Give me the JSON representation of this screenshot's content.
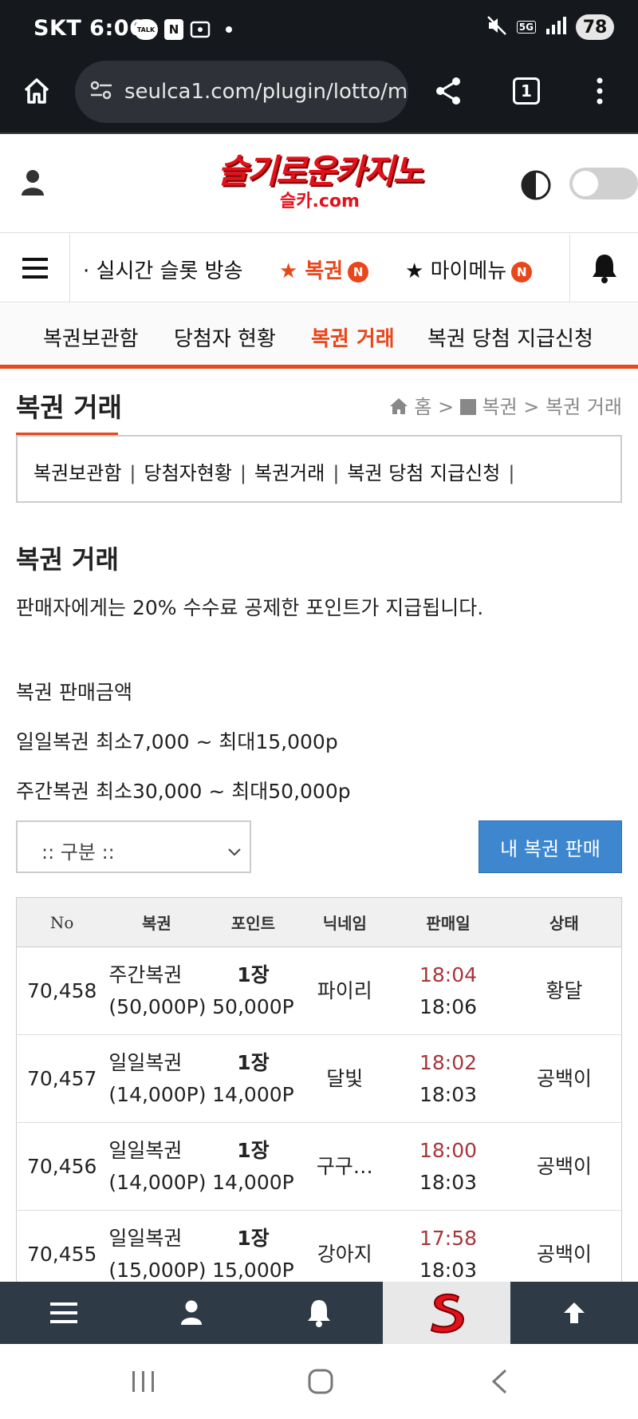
{
  "status": {
    "carrier_time": "SKT 6:06",
    "talk_label": "TALK",
    "n_label": "N",
    "net_label": "5G",
    "battery": "78"
  },
  "browser": {
    "url": "seulca1.com/plugin/lotto/m",
    "tab_count": "1"
  },
  "site": {
    "logo_main": "슬기로운카지노",
    "logo_sub": "슬카.com"
  },
  "main_nav": {
    "items": [
      {
        "label": "· 실시간 슬롯 방송"
      },
      {
        "label": "★ 복권",
        "badge": "N"
      },
      {
        "label": "★ 마이메뉴",
        "badge": "N"
      }
    ]
  },
  "sub_nav": {
    "items": [
      "복권보관함",
      "당첨자 현황",
      "복권 거래",
      "복권 당첨 지급신청"
    ]
  },
  "page": {
    "title": "복권 거래",
    "breadcrumb": [
      "홈",
      ">",
      "복권",
      ">",
      "복권 거래"
    ],
    "links": [
      "복권보관함",
      "당첨자현황",
      "복권거래",
      "복권 당첨 지급신청"
    ],
    "section_title": "복권 거래",
    "notice": "판매자에게는 20% 수수료 공제한 포인트가 지급됩니다.",
    "price_heading": "복권 판매금액",
    "daily_range": "일일복권 최소7,000 ~ 최대15,000p",
    "weekly_range": "주간복권 최소30,000 ~ 최대50,000p",
    "filter_selected": ":: 구분 ::",
    "sell_button": "내 복권 판매"
  },
  "table": {
    "headers": [
      "No",
      "복권",
      "포인트",
      "닉네임",
      "판매일",
      "상태"
    ],
    "rows": [
      {
        "no": "70,458",
        "ticket": "주간복권",
        "ticket_price": "(50,000P)",
        "qty": "1장",
        "points": "50,000P",
        "nick": "파이리",
        "time1": "18:04",
        "time2": "18:06",
        "status": "황달"
      },
      {
        "no": "70,457",
        "ticket": "일일복권",
        "ticket_price": "(14,000P)",
        "qty": "1장",
        "points": "14,000P",
        "nick": "달빛",
        "time1": "18:02",
        "time2": "18:03",
        "status": "공백이"
      },
      {
        "no": "70,456",
        "ticket": "일일복권",
        "ticket_price": "(14,000P)",
        "qty": "1장",
        "points": "14,000P",
        "nick": "구구…",
        "time1": "18:00",
        "time2": "18:03",
        "status": "공백이"
      },
      {
        "no": "70,455",
        "ticket": "일일복권",
        "ticket_price": "(15,000P)",
        "qty": "1장",
        "points": "15,000P",
        "nick": "강아지",
        "time1": "17:58",
        "time2": "18:03",
        "status": "공백이"
      }
    ]
  },
  "colors": {
    "accent": "#e8471b",
    "button_blue": "#3e87cf",
    "bottom_bar": "#2e3a45",
    "time_red": "#a8353a"
  }
}
